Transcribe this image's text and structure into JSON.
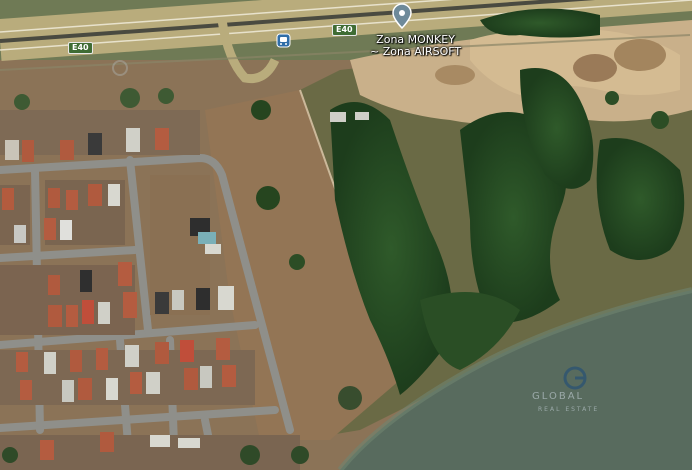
{
  "map": {
    "view": "satellite",
    "road_shields": [
      {
        "label": "E40"
      },
      {
        "label": "E40"
      }
    ],
    "place_marker": {
      "icon": "map-pin-icon",
      "name_line1": "Zona MONKEY",
      "name_line2": "~ Zona AIRSOFT"
    },
    "transit_icon": "bus-stop-icon",
    "watermark": {
      "brand": "GLOBAL",
      "tagline": "REAL ESTATE"
    }
  }
}
